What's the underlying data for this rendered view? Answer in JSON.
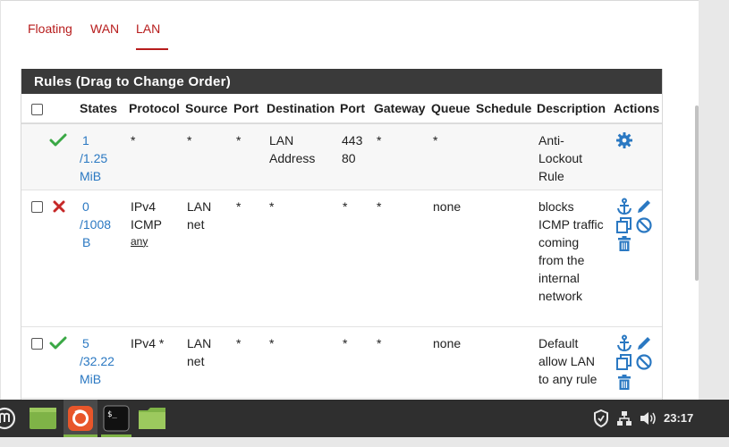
{
  "tabs": [
    {
      "label": "Floating"
    },
    {
      "label": "WAN"
    },
    {
      "label": "LAN",
      "active": true
    }
  ],
  "panel": {
    "title": "Rules (Drag to Change Order)"
  },
  "table": {
    "headers": [
      "States",
      "Protocol",
      "Source",
      "Port",
      "Destination",
      "Port",
      "Gateway",
      "Queue",
      "Schedule",
      "Description",
      "Actions"
    ],
    "rows": [
      {
        "status_icon": "check-icon",
        "states_line1": "1",
        "states_line2": "/1.25",
        "states_line3": "MiB",
        "protocol": "*",
        "protocol_sub": "",
        "source": "*",
        "source_port": "*",
        "destination": "LAN Address",
        "dest_port_line1": "443",
        "dest_port_line2": "80",
        "gateway": "*",
        "queue": "*",
        "schedule": "",
        "description": "Anti-Lockout Rule"
      },
      {
        "status_icon": "block-icon",
        "states_line1": "0",
        "states_line2": "/1008",
        "states_line3": "B",
        "protocol": "IPv4 ICMP",
        "protocol_sub": "any",
        "source": "LAN net",
        "source_port": "*",
        "destination": "*",
        "dest_port_line1": "*",
        "dest_port_line2": "",
        "gateway": "*",
        "queue": "none",
        "schedule": "",
        "description": "blocks ICMP traffic coming from the internal network"
      },
      {
        "status_icon": "check-icon",
        "states_line1": "5",
        "states_line2": "/32.22",
        "states_line3": "MiB",
        "protocol": "IPv4 *",
        "protocol_sub": "",
        "source": "LAN net",
        "source_port": "*",
        "destination": "*",
        "dest_port_line1": "*",
        "dest_port_line2": "",
        "gateway": "*",
        "queue": "none",
        "schedule": "",
        "description": "Default allow LAN to any rule"
      }
    ]
  },
  "taskbar": {
    "clock": "23:17",
    "apps": [
      "menu-icon",
      "files-icon",
      "firefox-icon",
      "terminal-icon",
      "folder-icon"
    ],
    "tray": [
      "shield-icon",
      "network-icon",
      "volume-icon"
    ]
  },
  "colors": {
    "accent_red": "#b71c1c",
    "link_blue": "#2a78c2",
    "pass_green": "#3aa845",
    "block_red": "#c62828",
    "header_dark": "#3a3a3a",
    "taskbar": "#2f2f2f"
  }
}
